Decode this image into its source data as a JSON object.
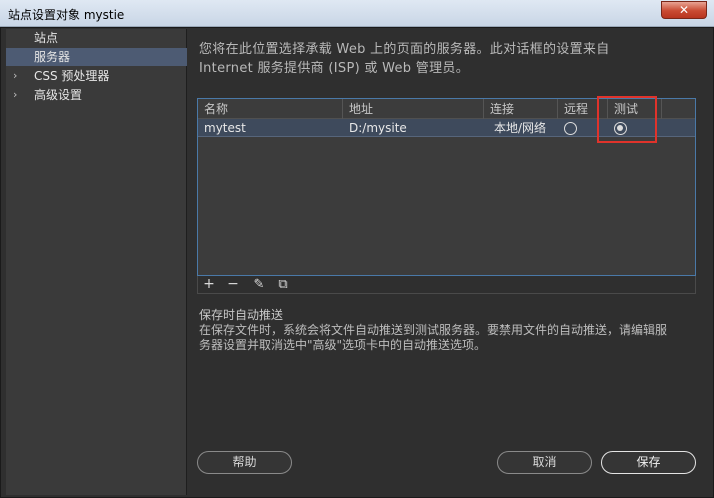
{
  "window": {
    "title": "站点设置对象 mystie",
    "close_label": "✕"
  },
  "sidebar": {
    "items": [
      {
        "label": "站点",
        "chevron": ""
      },
      {
        "label": "服务器",
        "chevron": ""
      },
      {
        "label": "CSS 预处理器",
        "chevron": "›"
      },
      {
        "label": "高级设置",
        "chevron": "›"
      }
    ],
    "selected_index": 1
  },
  "main": {
    "description_line1": "您将在此位置选择承载 Web 上的页面的服务器。此对话框的设置来自",
    "description_line2": "Internet 服务提供商 (ISP) 或 Web 管理员。",
    "table": {
      "columns": [
        "名称",
        "地址",
        "连接",
        "远程",
        "测试"
      ],
      "rows": [
        {
          "name": "mytest",
          "address": "D:/mysite",
          "connection": "本地/网络",
          "remote": false,
          "test": true
        }
      ]
    },
    "toolbar": {
      "add": "+",
      "remove": "−",
      "edit": "✎",
      "duplicate": "⧉"
    },
    "auto_push_title": "保存时自动推送",
    "auto_push_desc_line1": "在保存文件时，系统会将文件自动推送到测试服务器。要禁用文件的自动推送，请编辑服",
    "auto_push_desc_line2": "务器设置并取消选中\"高级\"选项卡中的自动推送选项。"
  },
  "buttons": {
    "help": "帮助",
    "cancel": "取消",
    "save": "保存"
  },
  "colors": {
    "selected_nav": "#4d5b73",
    "highlight_box": "#e0332b",
    "table_border": "#4a79a8"
  }
}
